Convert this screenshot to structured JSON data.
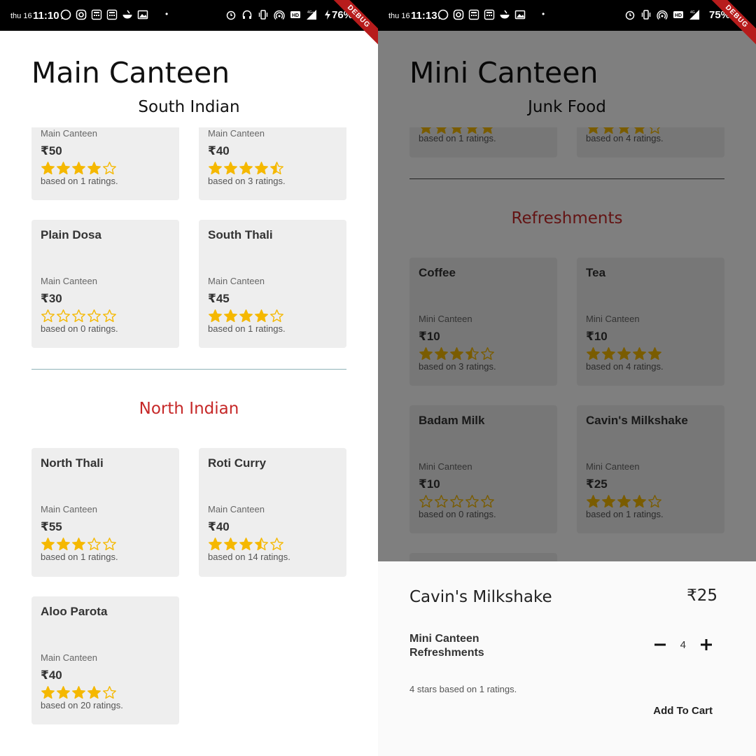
{
  "colors": {
    "star": "#f5b800",
    "section_red": "#c62828",
    "card_bg": "#eeeeee",
    "divider_teal": "#90b4b8"
  },
  "left": {
    "status": {
      "date": "thu 16",
      "time": "11:10",
      "battery": "76%",
      "net": "4G+"
    },
    "debug": "DEBUG",
    "title": "Main Canteen",
    "section1": "South Indian",
    "cards_south": [
      {
        "name": "",
        "location": "Main Canteen",
        "price": "₹50",
        "rating": 4,
        "ratings_text": "based on 1 ratings."
      },
      {
        "name": "",
        "location": "Main Canteen",
        "price": "₹40",
        "rating": 4.5,
        "ratings_text": "based on 3 ratings."
      },
      {
        "name": "Plain Dosa",
        "location": "Main Canteen",
        "price": "₹30",
        "rating": 0,
        "ratings_text": "based on 0 ratings."
      },
      {
        "name": "South Thali",
        "location": "Main Canteen",
        "price": "₹45",
        "rating": 4,
        "ratings_text": "based on 1 ratings."
      }
    ],
    "section2": "North Indian",
    "cards_north": [
      {
        "name": "North Thali",
        "location": "Main Canteen",
        "price": "₹55",
        "rating": 3,
        "ratings_text": "based on 1 ratings."
      },
      {
        "name": "Roti Curry",
        "location": "Main Canteen",
        "price": "₹40",
        "rating": 3.5,
        "ratings_text": "based on 14 ratings."
      },
      {
        "name": "Aloo Parota",
        "location": "Main Canteen",
        "price": "₹40",
        "rating": 4,
        "ratings_text": "based on 20 ratings."
      }
    ]
  },
  "right": {
    "status": {
      "date": "thu 16",
      "time": "11:13",
      "battery": "75%",
      "net": "4G"
    },
    "debug": "DEBUG",
    "title": "Mini Canteen",
    "section1": "Junk Food",
    "cards_junk": [
      {
        "rating": 5,
        "ratings_text": "based on 1 ratings."
      },
      {
        "rating": 4,
        "ratings_text": "based on 4 ratings."
      }
    ],
    "section2": "Refreshments",
    "cards_refresh": [
      {
        "name": "Coffee",
        "location": "Mini Canteen",
        "price": "₹10",
        "rating": 3.5,
        "ratings_text": "based on 3 ratings."
      },
      {
        "name": "Tea",
        "location": "Mini Canteen",
        "price": "₹10",
        "rating": 5,
        "ratings_text": "based on 4 ratings."
      },
      {
        "name": "Badam Milk",
        "location": "Mini Canteen",
        "price": "₹10",
        "rating": 0,
        "ratings_text": "based on 0 ratings."
      },
      {
        "name": "Cavin's Milkshake",
        "location": "Mini Canteen",
        "price": "₹25",
        "rating": 4,
        "ratings_text": "based on 1 ratings."
      }
    ],
    "sheet": {
      "name": "Cavin's Milkshake",
      "price": "₹25",
      "canteen": "Mini Canteen",
      "category": "Refreshments",
      "quantity": "4",
      "rating_text": "4 stars based on 1 ratings.",
      "add_label": "Add To Cart"
    }
  }
}
